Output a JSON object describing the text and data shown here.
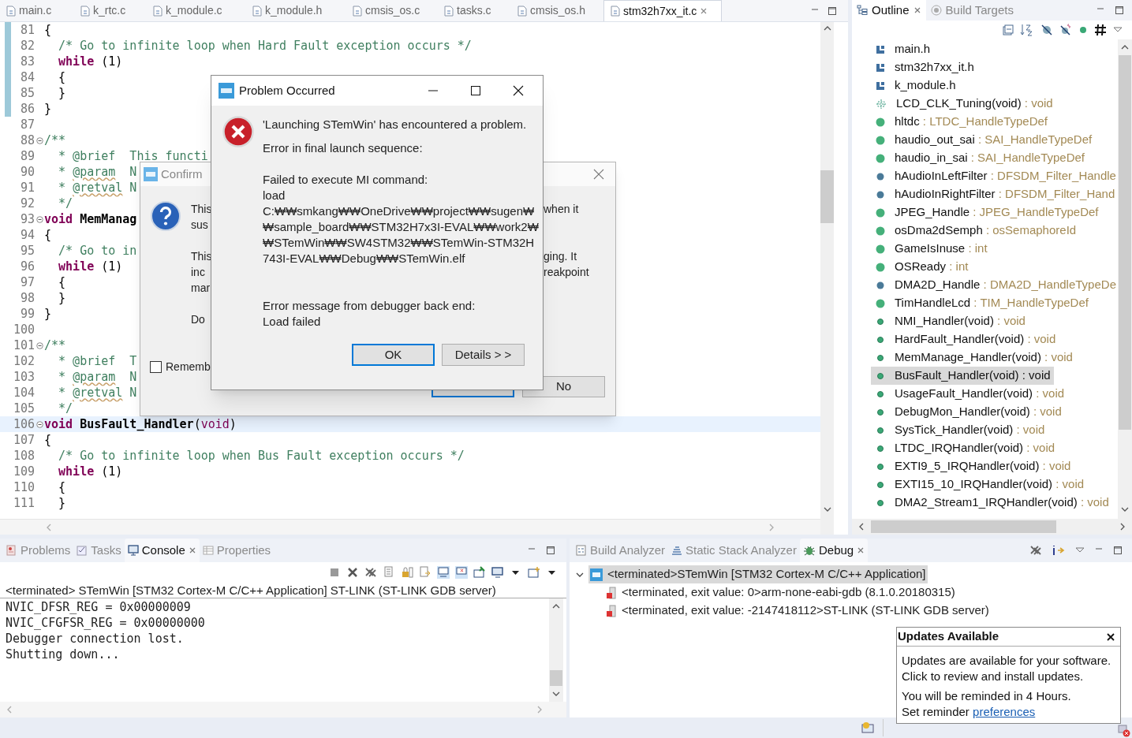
{
  "editor": {
    "tabs": [
      {
        "label": "main.c",
        "selected": false
      },
      {
        "label": "k_rtc.c",
        "selected": false
      },
      {
        "label": "k_module.c",
        "selected": false
      },
      {
        "label": "k_module.h",
        "selected": false
      },
      {
        "label": "cmsis_os.c",
        "selected": false
      },
      {
        "label": "tasks.c",
        "selected": false
      },
      {
        "label": "cmsis_os.h",
        "selected": false
      },
      {
        "label": "stm32h7xx_it.c",
        "selected": true
      }
    ],
    "lines": [
      {
        "number": "81",
        "changed": true,
        "fold": false,
        "current": false,
        "code": [
          {
            "kind": "plain",
            "text": "{"
          }
        ]
      },
      {
        "number": "82",
        "changed": true,
        "fold": false,
        "current": false,
        "code": [
          {
            "kind": "comment",
            "text": "  /* Go to infinite loop when Hard Fault exception occurs */"
          }
        ]
      },
      {
        "number": "83",
        "changed": true,
        "fold": false,
        "current": false,
        "code": [
          {
            "kind": "keyword",
            "text": "  while"
          },
          {
            "kind": "plain",
            "text": " (1)"
          }
        ]
      },
      {
        "number": "84",
        "changed": true,
        "fold": false,
        "current": false,
        "code": [
          {
            "kind": "plain",
            "text": "  {"
          }
        ]
      },
      {
        "number": "85",
        "changed": true,
        "fold": false,
        "current": false,
        "code": [
          {
            "kind": "plain",
            "text": "  }"
          }
        ]
      },
      {
        "number": "86",
        "changed": true,
        "fold": false,
        "current": false,
        "code": [
          {
            "kind": "plain",
            "text": "}"
          }
        ]
      },
      {
        "number": "87",
        "changed": false,
        "fold": false,
        "current": false
      },
      {
        "number": "88",
        "changed": false,
        "fold": true,
        "current": false,
        "code": [
          {
            "kind": "comment",
            "text": "/**"
          }
        ]
      },
      {
        "number": "89",
        "changed": false,
        "fold": false,
        "current": false,
        "code": [
          {
            "kind": "comment",
            "text": "  * @brief  This functi"
          }
        ]
      },
      {
        "number": "90",
        "changed": false,
        "fold": false,
        "current": false,
        "code": [
          {
            "kind": "comment",
            "text": "  * "
          },
          {
            "kind": "doc-tag",
            "text": "@param"
          },
          {
            "kind": "comment",
            "text": "  N"
          }
        ]
      },
      {
        "number": "91",
        "changed": false,
        "fold": false,
        "current": false,
        "code": [
          {
            "kind": "comment",
            "text": "  * "
          },
          {
            "kind": "doc-tag",
            "text": "@retval"
          },
          {
            "kind": "comment",
            "text": " N"
          }
        ]
      },
      {
        "number": "92",
        "changed": false,
        "fold": false,
        "current": false,
        "code": [
          {
            "kind": "comment",
            "text": "  */"
          }
        ]
      },
      {
        "number": "93",
        "changed": false,
        "fold": true,
        "current": false,
        "code": [
          {
            "kind": "keyword",
            "text": "void"
          },
          {
            "kind": "function-name",
            "text": " MemManag"
          }
        ]
      },
      {
        "number": "94",
        "changed": false,
        "fold": false,
        "current": false,
        "code": [
          {
            "kind": "plain",
            "text": "{"
          }
        ]
      },
      {
        "number": "95",
        "changed": false,
        "fold": false,
        "current": false,
        "code": [
          {
            "kind": "comment",
            "text": "  /* Go to in"
          }
        ]
      },
      {
        "number": "96",
        "changed": false,
        "fold": false,
        "current": false,
        "code": [
          {
            "kind": "keyword",
            "text": "  while"
          },
          {
            "kind": "plain",
            "text": " (1)"
          }
        ]
      },
      {
        "number": "97",
        "changed": false,
        "fold": false,
        "current": false,
        "code": [
          {
            "kind": "plain",
            "text": "  {"
          }
        ]
      },
      {
        "number": "98",
        "changed": false,
        "fold": false,
        "current": false,
        "code": [
          {
            "kind": "plain",
            "text": "  }"
          }
        ]
      },
      {
        "number": "99",
        "changed": false,
        "fold": false,
        "current": false,
        "code": [
          {
            "kind": "plain",
            "text": "}"
          }
        ]
      },
      {
        "number": "100",
        "changed": false,
        "fold": false,
        "current": false
      },
      {
        "number": "101",
        "changed": false,
        "fold": true,
        "current": false,
        "code": [
          {
            "kind": "comment",
            "text": "/**"
          }
        ]
      },
      {
        "number": "102",
        "changed": false,
        "fold": false,
        "current": false,
        "code": [
          {
            "kind": "comment",
            "text": "  * @brief  T"
          }
        ]
      },
      {
        "number": "103",
        "changed": false,
        "fold": false,
        "current": false,
        "code": [
          {
            "kind": "comment",
            "text": "  * "
          },
          {
            "kind": "doc-tag",
            "text": "@param"
          },
          {
            "kind": "comment",
            "text": "  N"
          }
        ]
      },
      {
        "number": "104",
        "changed": false,
        "fold": false,
        "current": false,
        "code": [
          {
            "kind": "comment",
            "text": "  * "
          },
          {
            "kind": "doc-tag",
            "text": "@retval"
          },
          {
            "kind": "comment",
            "text": " N"
          }
        ]
      },
      {
        "number": "105",
        "changed": false,
        "fold": false,
        "current": false,
        "code": [
          {
            "kind": "comment",
            "text": "  */"
          }
        ]
      },
      {
        "number": "106",
        "changed": false,
        "fold": true,
        "current": true,
        "code": [
          {
            "kind": "keyword",
            "text": "void"
          },
          {
            "kind": "function-name",
            "text": " BusFault_Handler"
          },
          {
            "kind": "plain",
            "text": "("
          },
          {
            "kind": "keyword-light",
            "text": "void"
          },
          {
            "kind": "plain",
            "text": ")"
          }
        ]
      },
      {
        "number": "107",
        "changed": false,
        "fold": false,
        "current": false,
        "code": [
          {
            "kind": "plain",
            "text": "{"
          }
        ]
      },
      {
        "number": "108",
        "changed": false,
        "fold": false,
        "current": false,
        "code": [
          {
            "kind": "comment",
            "text": "  /* Go to infinite loop when Bus Fault exception occurs */"
          }
        ]
      },
      {
        "number": "109",
        "changed": false,
        "fold": false,
        "current": false,
        "code": [
          {
            "kind": "keyword",
            "text": "  while"
          },
          {
            "kind": "plain",
            "text": " (1)"
          }
        ]
      },
      {
        "number": "110",
        "changed": false,
        "fold": false,
        "current": false,
        "code": [
          {
            "kind": "plain",
            "text": "  {"
          }
        ]
      },
      {
        "number": "111",
        "changed": false,
        "fold": false,
        "current": false,
        "code": [
          {
            "kind": "plain",
            "text": "  }"
          }
        ]
      }
    ]
  },
  "outline": {
    "tabs": [
      {
        "label": "Outline",
        "selected": true
      },
      {
        "label": "Build Targets",
        "selected": false
      }
    ],
    "items": [
      {
        "kind": "include",
        "name": "main.h",
        "selected": false
      },
      {
        "kind": "include",
        "name": "stm32h7xx_it.h",
        "selected": false
      },
      {
        "kind": "include",
        "name": "k_module.h",
        "selected": false
      },
      {
        "kind": "declaration",
        "name": "LCD_CLK_Tuning(void)",
        "type": ": void",
        "selected": false
      },
      {
        "kind": "variable",
        "name": "hltdc",
        "type": ": LTDC_HandleTypeDef",
        "selected": false
      },
      {
        "kind": "variable",
        "name": "haudio_out_sai",
        "type": ": SAI_HandleTypeDef",
        "selected": false
      },
      {
        "kind": "variable",
        "name": "haudio_in_sai",
        "type": ": SAI_HandleTypeDef",
        "selected": false
      },
      {
        "kind": "static-variable",
        "name": "hAudioInLeftFilter",
        "type": ": DFSDM_Filter_Handle",
        "selected": false
      },
      {
        "kind": "static-variable",
        "name": "hAudioInRightFilter",
        "type": ": DFSDM_Filter_Hand",
        "selected": false
      },
      {
        "kind": "variable",
        "name": "JPEG_Handle",
        "type": ": JPEG_HandleTypeDef",
        "selected": false
      },
      {
        "kind": "variable",
        "name": "osDma2dSemph",
        "type": ": osSemaphoreId",
        "selected": false
      },
      {
        "kind": "variable",
        "name": "GameIsInuse",
        "type": ": int",
        "selected": false
      },
      {
        "kind": "variable",
        "name": "OSReady",
        "type": ": int",
        "selected": false
      },
      {
        "kind": "static-variable",
        "name": "DMA2D_Handle",
        "type": ": DMA2D_HandleTypeDe",
        "selected": false
      },
      {
        "kind": "variable",
        "name": "TimHandleLcd",
        "type": ": TIM_HandleTypeDef",
        "selected": false
      },
      {
        "kind": "function",
        "name": "NMI_Handler(void)",
        "type": ": void",
        "selected": false
      },
      {
        "kind": "function",
        "name": "HardFault_Handler(void)",
        "type": ": void",
        "selected": false
      },
      {
        "kind": "function",
        "name": "MemManage_Handler(void)",
        "type": ": void",
        "selected": false
      },
      {
        "kind": "function",
        "name": "BusFault_Handler(void)",
        "type": ": void",
        "selected": true
      },
      {
        "kind": "function",
        "name": "UsageFault_Handler(void)",
        "type": ": void",
        "selected": false
      },
      {
        "kind": "function",
        "name": "DebugMon_Handler(void)",
        "type": ": void",
        "selected": false
      },
      {
        "kind": "function",
        "name": "SysTick_Handler(void)",
        "type": ": void",
        "selected": false
      },
      {
        "kind": "function",
        "name": "LTDC_IRQHandler(void)",
        "type": ": void",
        "selected": false
      },
      {
        "kind": "function",
        "name": "EXTI9_5_IRQHandler(void)",
        "type": ": void",
        "selected": false
      },
      {
        "kind": "function",
        "name": "EXTI15_10_IRQHandler(void)",
        "type": ": void",
        "selected": false
      },
      {
        "kind": "function",
        "name": "DMA2_Stream1_IRQHandler(void)",
        "type": ": void",
        "selected": false
      }
    ]
  },
  "console": {
    "tabs": [
      {
        "label": "Problems",
        "selected": false
      },
      {
        "label": "Tasks",
        "selected": false
      },
      {
        "label": "Console",
        "selected": true
      },
      {
        "label": "Properties",
        "selected": false
      }
    ],
    "process": "<terminated> STemWin [STM32 Cortex-M C/C++ Application] ST-LINK (ST-LINK GDB server)",
    "output": [
      "NVIC_DFSR_REG = 0x00000009",
      "NVIC_CFGFSR_REG = 0x00000000",
      "Debugger connection lost.",
      "Shutting down..."
    ]
  },
  "debug": {
    "tabs": [
      {
        "label": "Build Analyzer",
        "selected": false
      },
      {
        "label": "Static Stack Analyzer",
        "selected": false
      },
      {
        "label": "Debug",
        "selected": true
      }
    ],
    "tree": [
      {
        "label": "<terminated>STemWin [STM32 Cortex-M C/C++ Application]",
        "expanded": true,
        "selected": true,
        "children": [
          {
            "label": "<terminated, exit value: 0>arm-none-eabi-gdb (8.1.0.20180315)",
            "selected": false
          },
          {
            "label": "<terminated, exit value: -2147418112>ST-LINK (ST-LINK GDB server)",
            "selected": false
          }
        ]
      }
    ]
  },
  "confirm_dialog": {
    "title": "Confirm",
    "left_lines": [
      "This",
      "sus",
      "This",
      "inc",
      "mar",
      "Do"
    ],
    "right_lines": [
      "when it",
      "ging. It",
      "reakpoint"
    ],
    "checkbox": {
      "label": "Rememb",
      "checked": false
    },
    "buttons": [
      {
        "kind": "default"
      },
      {
        "kind": "normal",
        "label": "No"
      }
    ]
  },
  "problem_dialog": {
    "title": "Problem Occurred",
    "heading": "'Launching STemWin' has encountered a problem.",
    "paragraphs": [
      "Error in final launch sequence:",
      "Failed to execute MI command:\nload\nC:₩₩smkang₩₩OneDrive₩₩project₩₩sugen₩₩sample_board₩₩STM32H7x3I-EVAL₩₩work2₩₩STemWin₩₩SW4STM32₩₩STemWin-STM32H743I-EVAL₩₩Debug₩₩STemWin.elf",
      "Error message from debugger back end:\nLoad failed"
    ],
    "buttons": [
      {
        "label": "OK",
        "default": true
      },
      {
        "label": "Details > >",
        "default": false
      }
    ]
  },
  "updates_popup": {
    "title": "Updates Available",
    "message": "Updates are available for your software. Click to review and install updates.",
    "reminder": "You will be reminded in 4 Hours.",
    "link_prefix": "Set reminder",
    "link": "preferences"
  }
}
